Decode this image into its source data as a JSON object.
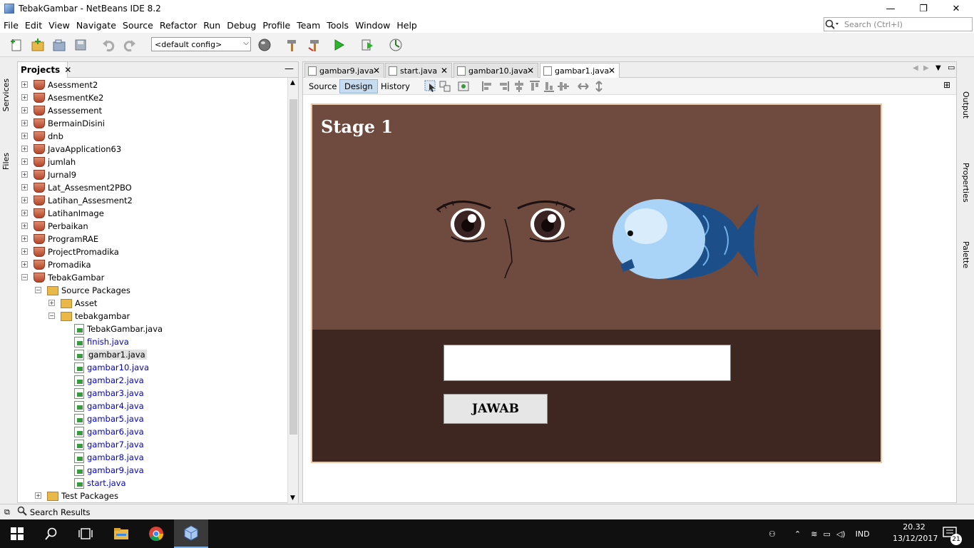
{
  "window": {
    "title": "TebakGambar - NetBeans IDE 8.2",
    "minimize_glyph": "—",
    "restore_glyph": "❐",
    "close_glyph": "✕"
  },
  "menu": [
    "File",
    "Edit",
    "View",
    "Navigate",
    "Source",
    "Refactor",
    "Run",
    "Debug",
    "Profile",
    "Team",
    "Tools",
    "Window",
    "Help"
  ],
  "search": {
    "placeholder": "Search (Ctrl+I)"
  },
  "toolbar": {
    "config": "<default config>"
  },
  "left_strip": {
    "services": "Services",
    "files": "Files"
  },
  "right_strip": {
    "output": "Output",
    "properties": "Properties",
    "palette": "Palette"
  },
  "projects": {
    "tab_label": "Projects",
    "tree": [
      {
        "label": "Asessment2",
        "type": "project"
      },
      {
        "label": "AsesmentKe2",
        "type": "project"
      },
      {
        "label": "Assessement",
        "type": "project"
      },
      {
        "label": "BermainDisini",
        "type": "project"
      },
      {
        "label": "dnb",
        "type": "project"
      },
      {
        "label": "JavaApplication63",
        "type": "project"
      },
      {
        "label": "jumlah",
        "type": "project"
      },
      {
        "label": "Jurnal9",
        "type": "project"
      },
      {
        "label": "Lat_Assesment2PBO",
        "type": "project"
      },
      {
        "label": "Latihan_Assesment2",
        "type": "project"
      },
      {
        "label": "LatihanImage",
        "type": "project"
      },
      {
        "label": "Perbaikan",
        "type": "project"
      },
      {
        "label": "ProgramRAE",
        "type": "project"
      },
      {
        "label": "ProjectPromadika",
        "type": "project"
      },
      {
        "label": "Promadika",
        "type": "project"
      },
      {
        "label": "TebakGambar",
        "type": "project"
      },
      {
        "label": "Source Packages",
        "type": "srcpkg"
      },
      {
        "label": "Asset",
        "type": "package"
      },
      {
        "label": "tebakgambar",
        "type": "package"
      },
      {
        "label": "TebakGambar.java",
        "type": "file"
      },
      {
        "label": "finish.java",
        "type": "file-mod"
      },
      {
        "label": "gambar1.java",
        "type": "file-selected"
      },
      {
        "label": "gambar10.java",
        "type": "file-mod"
      },
      {
        "label": "gambar2.java",
        "type": "file-mod"
      },
      {
        "label": "gambar3.java",
        "type": "file-mod"
      },
      {
        "label": "gambar4.java",
        "type": "file-mod"
      },
      {
        "label": "gambar5.java",
        "type": "file-mod"
      },
      {
        "label": "gambar6.java",
        "type": "file-mod"
      },
      {
        "label": "gambar7.java",
        "type": "file-mod"
      },
      {
        "label": "gambar8.java",
        "type": "file-mod"
      },
      {
        "label": "gambar9.java",
        "type": "file-mod"
      },
      {
        "label": "start.java",
        "type": "file-mod"
      },
      {
        "label": "Test Packages",
        "type": "srcpkg"
      }
    ]
  },
  "editor": {
    "tabs": [
      {
        "label": "gambar9.java"
      },
      {
        "label": "start.java"
      },
      {
        "label": "gambar10.java"
      },
      {
        "label": "gambar1.java",
        "active": true
      }
    ],
    "views": [
      "Source",
      "Design",
      "History"
    ]
  },
  "form": {
    "stage_label": "Stage 1",
    "answer_value": "",
    "submit_label": "JAWAB"
  },
  "bottom": {
    "search_results": "Search Results"
  },
  "taskbar": {
    "time": "20.32",
    "date": "13/12/2017",
    "lang": "IND",
    "notif_count": "21"
  }
}
